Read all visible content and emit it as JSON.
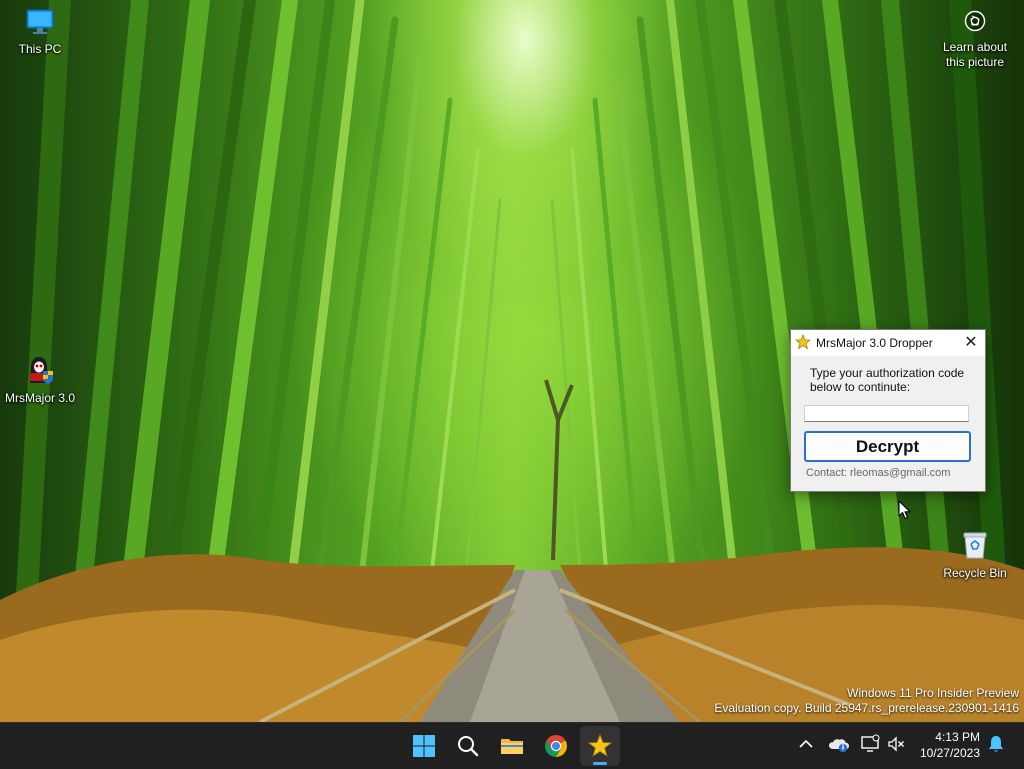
{
  "desktop": {
    "icons": [
      {
        "label": "This PC",
        "icon": "computer-monitor-icon"
      },
      {
        "label": "MrsMajor 3.0",
        "icon": "mrsmajor-reaper-icon"
      },
      {
        "label": "Recycle Bin",
        "icon": "recycle-bin-icon"
      }
    ],
    "learn_picture": {
      "line1": "Learn about",
      "line2": "this picture",
      "icon": "camera-icon"
    }
  },
  "dialog": {
    "title": "MrsMajor 3.0 Dropper",
    "title_icon": "star-icon",
    "close_label": "✕",
    "prompt": "Type your authorization code below to continute:",
    "input_value": "",
    "input_placeholder": "",
    "button_label": "Decrypt",
    "contact": "Contact: rleomas@gmail.com",
    "accent_color": "#2a6fd3"
  },
  "watermark": {
    "line1": "Windows 11 Pro Insider Preview",
    "line2": "Evaluation copy. Build 25947.rs_prerelease.230901-1416"
  },
  "taskbar": {
    "apps": [
      "start-icon",
      "search-icon",
      "file-explorer-icon",
      "chrome-icon",
      "mrsmajor-star-icon"
    ],
    "active_app": "mrsmajor-star-icon",
    "tray": [
      "chevron-up-icon",
      "onedrive-icon",
      "display-icon",
      "volume-muted-icon",
      "notification-bell-icon"
    ],
    "time": "4:13 PM",
    "date": "10/27/2023"
  }
}
